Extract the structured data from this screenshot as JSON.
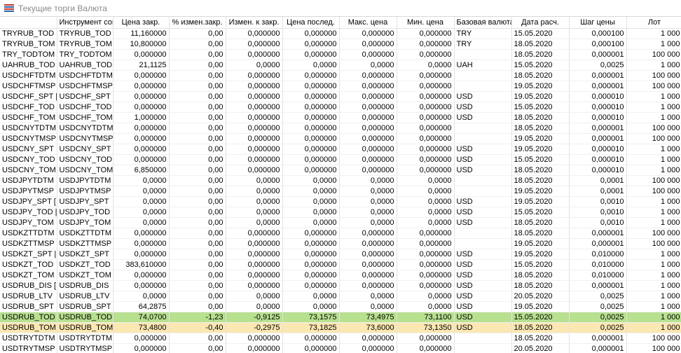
{
  "window": {
    "title": "Текущие торги Валюта",
    "icon": "table-list-icon"
  },
  "columns": [
    "",
    "Инструмент сок",
    "Цена закр.",
    "% измен.закр.",
    "Измен. к закр.",
    "Цена послед.",
    "Макс. цена",
    "Мин. цена",
    "Базовая валюта",
    "Дата расч.",
    "Шаг цены",
    "Лот"
  ],
  "rows": [
    {
      "c": [
        "TRYRUB_TOD",
        "TRYRUB_TOD",
        "11,160000",
        "0,00",
        "0,000000",
        "0,000000",
        "0,000000",
        "0,000000",
        "TRY",
        "15.05.2020",
        "0,000100",
        "1 000"
      ]
    },
    {
      "c": [
        "TRYRUB_TOM",
        "TRYRUB_TOM",
        "10,800000",
        "0,00",
        "0,000000",
        "0,000000",
        "0,000000",
        "0,000000",
        "TRY",
        "18.05.2020",
        "0,000100",
        "1 000"
      ]
    },
    {
      "c": [
        "TRY_TODTOM",
        "TRY_TODTOM",
        "0,000000",
        "0,00",
        "0,000000",
        "0,000000",
        "0,000000",
        "0,000000",
        "",
        "18.05.2020",
        "0,000001",
        "100 000"
      ]
    },
    {
      "c": [
        "UAHRUB_TOD",
        "UAHRUB_TOD",
        "21,1125",
        "0,00",
        "0,0000",
        "0,0000",
        "0,0000",
        "0,0000",
        "UAH",
        "15.05.2020",
        "0,0025",
        "1 000"
      ]
    },
    {
      "c": [
        "USDCHFTDTM",
        "USDCHFTDTM",
        "0,000000",
        "0,00",
        "0,000000",
        "0,000000",
        "0,000000",
        "0,000000",
        "",
        "18.05.2020",
        "0,000001",
        "100 000"
      ]
    },
    {
      "c": [
        "USDCHFTMSP",
        "USDCHFTMSP",
        "0,000000",
        "0,00",
        "0,000000",
        "0,000000",
        "0,000000",
        "0,000000",
        "",
        "19.05.2020",
        "0,000001",
        "100 000"
      ]
    },
    {
      "c": [
        "USDCHF_SPT |",
        "USDCHF_SPT",
        "0,000000",
        "0,00",
        "0,000000",
        "0,000000",
        "0,000000",
        "0,000000",
        "USD",
        "19.05.2020",
        "0,000010",
        "1 000"
      ]
    },
    {
      "c": [
        "USDCHF_TOD",
        "USDCHF_TOD",
        "0,000000",
        "0,00",
        "0,000000",
        "0,000000",
        "0,000000",
        "0,000000",
        "USD",
        "15.05.2020",
        "0,000010",
        "1 000"
      ]
    },
    {
      "c": [
        "USDCHF_TOM",
        "USDCHF_TOM",
        "1,000000",
        "0,00",
        "0,000000",
        "0,000000",
        "0,000000",
        "0,000000",
        "USD",
        "18.05.2020",
        "0,000010",
        "1 000"
      ]
    },
    {
      "c": [
        "USDCNYTDTM",
        "USDCNYTDTM",
        "0,000000",
        "0,00",
        "0,000000",
        "0,000000",
        "0,000000",
        "0,000000",
        "",
        "18.05.2020",
        "0,000001",
        "100 000"
      ]
    },
    {
      "c": [
        "USDCNYTMSP",
        "USDCNYTMSP",
        "0,000000",
        "0,00",
        "0,000000",
        "0,000000",
        "0,000000",
        "0,000000",
        "",
        "19.05.2020",
        "0,000001",
        "100 000"
      ]
    },
    {
      "c": [
        "USDCNY_SPT",
        "USDCNY_SPT",
        "0,000000",
        "0,00",
        "0,000000",
        "0,000000",
        "0,000000",
        "0,000000",
        "USD",
        "19.05.2020",
        "0,000010",
        "1 000"
      ]
    },
    {
      "c": [
        "USDCNY_TOD",
        "USDCNY_TOD",
        "0,000000",
        "0,00",
        "0,000000",
        "0,000000",
        "0,000000",
        "0,000000",
        "USD",
        "15.05.2020",
        "0,000010",
        "1 000"
      ]
    },
    {
      "c": [
        "USDCNY_TOM",
        "USDCNY_TOM",
        "6,850000",
        "0,00",
        "0,000000",
        "0,000000",
        "0,000000",
        "0,000000",
        "USD",
        "18.05.2020",
        "0,000010",
        "1 000"
      ]
    },
    {
      "c": [
        "USDJPYTDTM",
        "USDJPYTDTM",
        "0,0000",
        "0,00",
        "0,0000",
        "0,0000",
        "0,0000",
        "0,0000",
        "",
        "18.05.2020",
        "0,0001",
        "100 000"
      ]
    },
    {
      "c": [
        "USDJPYTMSP",
        "USDJPYTMSP",
        "0,0000",
        "0,00",
        "0,0000",
        "0,0000",
        "0,0000",
        "0,0000",
        "",
        "19.05.2020",
        "0,0001",
        "100 000"
      ]
    },
    {
      "c": [
        "USDJPY_SPT [",
        "USDJPY_SPT",
        "0,0000",
        "0,00",
        "0,0000",
        "0,0000",
        "0,0000",
        "0,0000",
        "USD",
        "19.05.2020",
        "0,0010",
        "1 000"
      ]
    },
    {
      "c": [
        "USDJPY_TOD |",
        "USDJPY_TOD",
        "0,0000",
        "0,00",
        "0,0000",
        "0,0000",
        "0,0000",
        "0,0000",
        "USD",
        "15.05.2020",
        "0,0010",
        "1 000"
      ]
    },
    {
      "c": [
        "USDJPY_TOM",
        "USDJPY_TOM",
        "0,0000",
        "0,00",
        "0,0000",
        "0,0000",
        "0,0000",
        "0,0000",
        "USD",
        "18.05.2020",
        "0,0010",
        "1 000"
      ]
    },
    {
      "c": [
        "USDKZTTDTM",
        "USDKZTTDTM",
        "0,000000",
        "0,00",
        "0,000000",
        "0,000000",
        "0,000000",
        "0,000000",
        "",
        "18.05.2020",
        "0,000001",
        "100 000"
      ]
    },
    {
      "c": [
        "USDKZTTMSP",
        "USDKZTTMSP",
        "0,000000",
        "0,00",
        "0,000000",
        "0,000000",
        "0,000000",
        "0,000000",
        "",
        "19.05.2020",
        "0,000001",
        "100 000"
      ]
    },
    {
      "c": [
        "USDKZT_SPT |",
        "USDKZT_SPT",
        "0,000000",
        "0,00",
        "0,000000",
        "0,000000",
        "0,000000",
        "0,000000",
        "USD",
        "19.05.2020",
        "0,010000",
        "1 000"
      ]
    },
    {
      "c": [
        "USDKZT_TOD",
        "USDKZT_TOD",
        "383,610000",
        "0,00",
        "0,000000",
        "0,000000",
        "0,000000",
        "0,000000",
        "USD",
        "15.05.2020",
        "0,010000",
        "1 000"
      ]
    },
    {
      "c": [
        "USDKZT_TOM",
        "USDKZT_TOM",
        "0,000000",
        "0,00",
        "0,000000",
        "0,000000",
        "0,000000",
        "0,000000",
        "USD",
        "18.05.2020",
        "0,010000",
        "1 000"
      ]
    },
    {
      "c": [
        "USDRUB_DIS [",
        "USDRUB_DIS",
        "0,000000",
        "0,00",
        "0,000000",
        "0,000000",
        "0,000000",
        "0,000000",
        "USD",
        "18.05.2020",
        "0,000001",
        "1 000"
      ]
    },
    {
      "c": [
        "USDRUB_LTV",
        "USDRUB_LTV",
        "0,0000",
        "0,00",
        "0,0000",
        "0,0000",
        "0,0000",
        "0,0000",
        "USD",
        "20.05.2020",
        "0,0025",
        "1 000"
      ]
    },
    {
      "c": [
        "USDRUB_SPT",
        "USDRUB_SPT",
        "64,2875",
        "0,00",
        "0,0000",
        "0,0000",
        "0,0000",
        "0,0000",
        "USD",
        "19.05.2020",
        "0,0025",
        "1 000"
      ]
    },
    {
      "c": [
        "USDRUB_TOD",
        "USDRUB_TOD",
        "74,0700",
        "-1,23",
        "-0,9125",
        "73,1575",
        "73,4975",
        "73,1100",
        "USD",
        "15.05.2020",
        "0,0025",
        "1 000"
      ],
      "highlight": "green"
    },
    {
      "c": [
        "USDRUB_TOM",
        "USDRUB_TOM",
        "73,4800",
        "-0,40",
        "-0,2975",
        "73,1825",
        "73,6000",
        "73,1350",
        "USD",
        "18.05.2020",
        "0,0025",
        "1 000"
      ],
      "highlight": "yellow"
    },
    {
      "c": [
        "USDTRYTDTM",
        "USDTRYTDTM",
        "0,000000",
        "0,00",
        "0,000000",
        "0,000000",
        "0,000000",
        "0,000000",
        "",
        "18.05.2020",
        "0,000001",
        "100 000"
      ]
    },
    {
      "c": [
        "USDTRYTMSP",
        "USDTRYTMSP",
        "0,000000",
        "0,00",
        "0,000000",
        "0,000000",
        "0,000000",
        "0,000000",
        "",
        "20.05.2020",
        "0,000001",
        "100 000"
      ]
    }
  ],
  "colors": {
    "green_row": "#b7e08f",
    "yellow_row": "#fbe7b2",
    "title_text": "#8a8a8a"
  }
}
